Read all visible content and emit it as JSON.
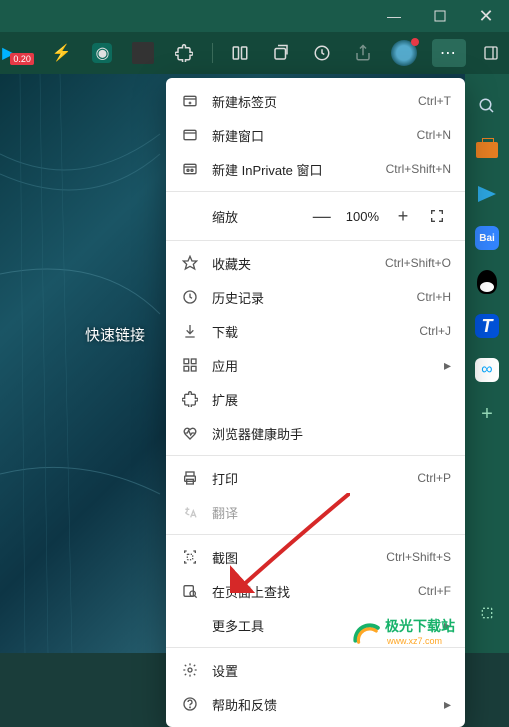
{
  "window": {
    "title": "",
    "controls": {
      "min": "—",
      "max": "🗖",
      "close": "✕"
    }
  },
  "toolbar": {
    "badge": "0.20"
  },
  "content": {
    "quick_link": "快速链接"
  },
  "menu": {
    "new_tab": "新建标签页",
    "new_tab_sc": "Ctrl+T",
    "new_window": "新建窗口",
    "new_window_sc": "Ctrl+N",
    "new_inprivate": "新建 InPrivate 窗口",
    "new_inprivate_sc": "Ctrl+Shift+N",
    "zoom": "缩放",
    "zoom_value": "100%",
    "favorites": "收藏夹",
    "favorites_sc": "Ctrl+Shift+O",
    "history": "历史记录",
    "history_sc": "Ctrl+H",
    "downloads": "下载",
    "downloads_sc": "Ctrl+J",
    "apps": "应用",
    "extensions": "扩展",
    "health": "浏览器健康助手",
    "print": "打印",
    "print_sc": "Ctrl+P",
    "translate": "翻译",
    "screenshot": "截图",
    "screenshot_sc": "Ctrl+Shift+S",
    "find": "在页面上查找",
    "find_sc": "Ctrl+F",
    "more_tools": "更多工具",
    "settings": "设置",
    "help": "帮助和反馈"
  },
  "sidebar": {
    "baidu": "Bai",
    "tencent": "T",
    "cloud": "∞"
  },
  "watermark": {
    "text": "极光下载站",
    "sub": "www.xz7.com"
  }
}
